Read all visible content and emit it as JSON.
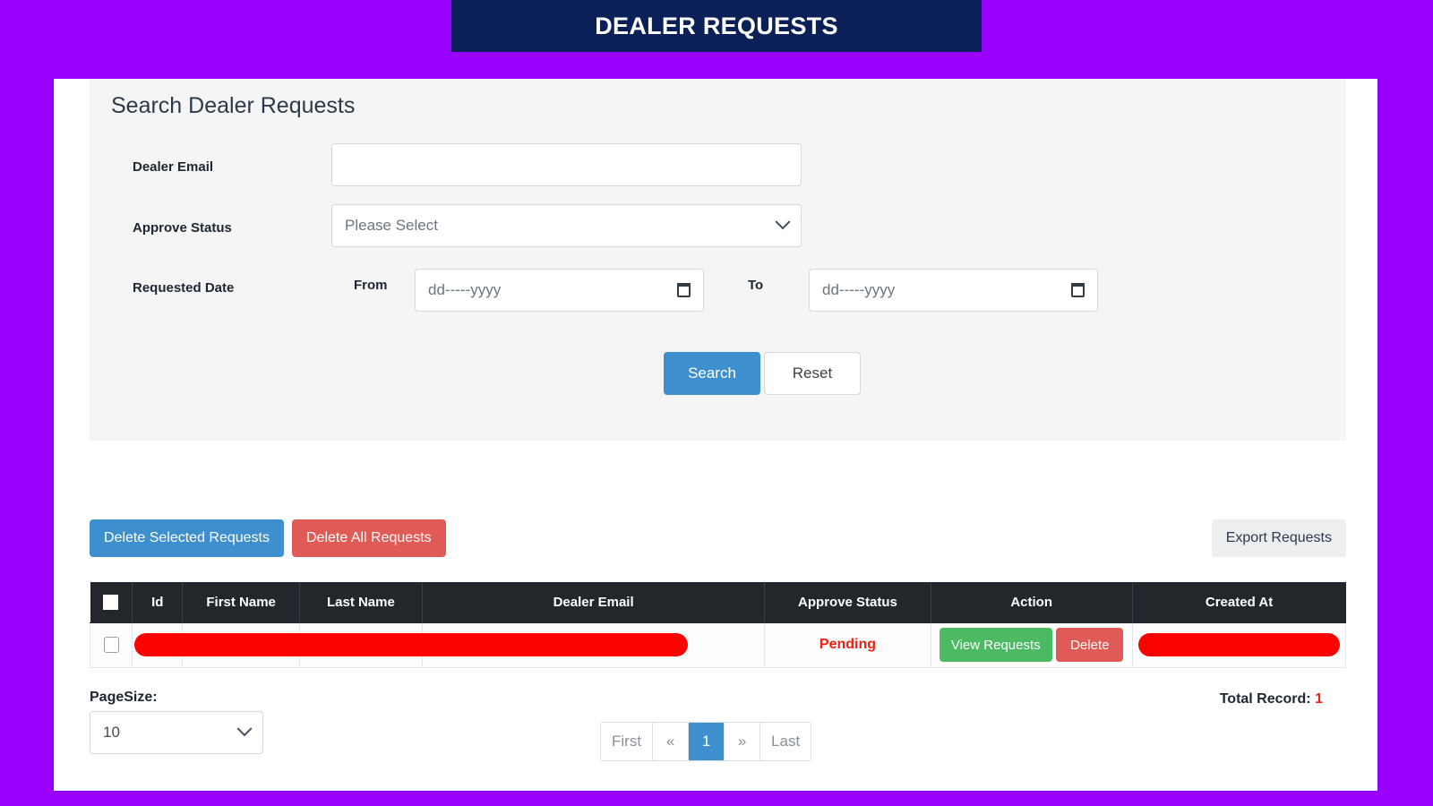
{
  "header": {
    "title": "DEALER REQUESTS",
    "banner_bg": "#0b2057",
    "page_bg": "#9900ff"
  },
  "search_panel": {
    "title": "Search Dealer Requests",
    "fields": {
      "dealer_email": {
        "label": "Dealer Email",
        "value": "",
        "placeholder": ""
      },
      "approve_status": {
        "label": "Approve Status",
        "selected": "Please Select"
      },
      "requested_date": {
        "label": "Requested Date",
        "from_label": "From",
        "from_placeholder": "dd-----yyyy",
        "from_value": "",
        "to_label": "To",
        "to_placeholder": "dd-----yyyy",
        "to_value": ""
      }
    },
    "buttons": {
      "search": "Search",
      "reset": "Reset"
    }
  },
  "action_bar": {
    "delete_selected": "Delete Selected Requests",
    "delete_all": "Delete All Requests",
    "export": "Export Requests"
  },
  "table": {
    "columns": [
      "",
      "Id",
      "First Name",
      "Last Name",
      "Dealer Email",
      "Approve Status",
      "Action",
      "Created At"
    ],
    "rows": [
      {
        "id": "",
        "first_name": "",
        "last_name": "",
        "dealer_email": "",
        "approve_status": "Pending",
        "view_label": "View Requests",
        "delete_label": "Delete",
        "created_at": "",
        "redacted": true
      }
    ]
  },
  "footer": {
    "pagesize_label": "PageSize:",
    "pagesize_value": "10",
    "total_record_label": "Total Record:",
    "total_record_value": "1",
    "pagination": {
      "first": "First",
      "prev": "«",
      "pages": [
        "1"
      ],
      "next": "»",
      "last": "Last",
      "active": "1"
    }
  },
  "colors": {
    "accent_blue": "#3d8fcd",
    "danger_red": "#e05b55",
    "success_green": "#4cb963",
    "status_red": "#f01e14",
    "table_header": "#23272b"
  }
}
